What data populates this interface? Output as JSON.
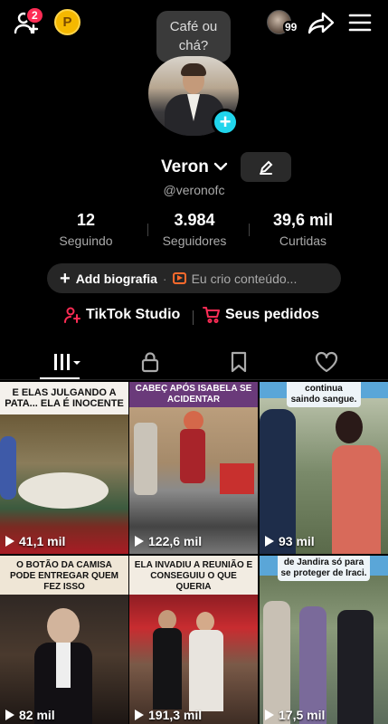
{
  "topbar": {
    "notif_count": "2",
    "coin_letter": "P",
    "friends_count": "99"
  },
  "status_bubble": "Café ou chá?",
  "profile": {
    "name": "Veron",
    "username": "@veronofc"
  },
  "stats": [
    {
      "value": "12",
      "label": "Seguindo"
    },
    {
      "value": "3.984",
      "label": "Seguidores"
    },
    {
      "value": "39,6 mil",
      "label": "Curtidas"
    }
  ],
  "bio": {
    "add_label": "Add biografia",
    "creator_label": "Eu crio conteúdo..."
  },
  "links": {
    "studio": "TikTok Studio",
    "orders": "Seus pedidos"
  },
  "colors": {
    "accent_cyan": "#20d5ec",
    "accent_red": "#fe2c55",
    "coin": "#f5b800"
  },
  "videos": [
    {
      "caption": "E ELAS JULGANDO A PATA... ELA É INOCENTE",
      "views": "41,1 mil"
    },
    {
      "caption": "CABEÇ APÓS ISABELA SE ACIDENTAR",
      "views": "122,6 mil"
    },
    {
      "caption": "continua saindo sangue.",
      "views": "93 mil"
    },
    {
      "caption": "O BOTÃO DA CAMISA PODE ENTREGAR QUEM FEZ ISSO",
      "views": "82 mil"
    },
    {
      "caption": "ELA INVADIU A REUNIÃO E CONSEGUIU O QUE QUERIA",
      "views": "191,3 mil"
    },
    {
      "caption": "de Jandira só para se proteger de Iraci.",
      "views": "17,5 mil"
    }
  ]
}
